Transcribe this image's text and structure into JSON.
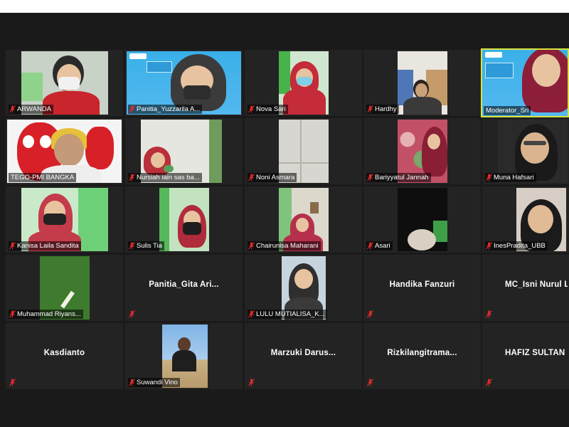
{
  "meeting": {
    "participants": [
      {
        "name": "ARWANDA",
        "muted": true
      },
      {
        "name": "Panitia_Yuzzarila A...",
        "muted": true
      },
      {
        "name": "Nova Sari",
        "muted": true
      },
      {
        "name": "Hardhy",
        "muted": true
      },
      {
        "name": "Moderator_Sri",
        "muted": false,
        "speaking": true
      },
      {
        "name": "TEGO-PMI BANGKA",
        "muted": false
      },
      {
        "name": "Nursiah iain sas ba...",
        "muted": true
      },
      {
        "name": "Noni Asmara",
        "muted": true
      },
      {
        "name": "Bariyyatul Jannah",
        "muted": true
      },
      {
        "name": "Muna Hafsari",
        "muted": true
      },
      {
        "name": "Kanisa Laila Sandita",
        "muted": true
      },
      {
        "name": "Sulis Tia",
        "muted": true
      },
      {
        "name": "Chairunisa Maharani",
        "muted": true
      },
      {
        "name": "Asari",
        "muted": true
      },
      {
        "name": "InesPradita_UBB",
        "muted": true
      },
      {
        "name": "Muhammad Riyans...",
        "muted": true
      },
      {
        "name": "Panitia_Gita  Ari...",
        "muted": true,
        "video_off": true
      },
      {
        "name": "LULU MUTIALISA_K...",
        "muted": true
      },
      {
        "name": "Handika Fanzuri",
        "muted": true,
        "video_off": true
      },
      {
        "name": "MC_Isni  Nurul  L...",
        "muted": true,
        "video_off": true
      },
      {
        "name": "Kasdianto",
        "muted": true,
        "video_off": true
      },
      {
        "name": "Suwandi Vino",
        "muted": true
      },
      {
        "name": "Marzuki  Darus...",
        "muted": true,
        "video_off": true
      },
      {
        "name": "Rizkilangitrama...",
        "muted": true,
        "video_off": true
      },
      {
        "name": "HAFIZ SULTAN F...",
        "muted": true,
        "video_off": true
      }
    ]
  },
  "colors": {
    "background": "#1a1a1a",
    "tile": "#232323",
    "active_speaker_border": "#d8e23a",
    "muted_icon": "#e02b2b"
  }
}
